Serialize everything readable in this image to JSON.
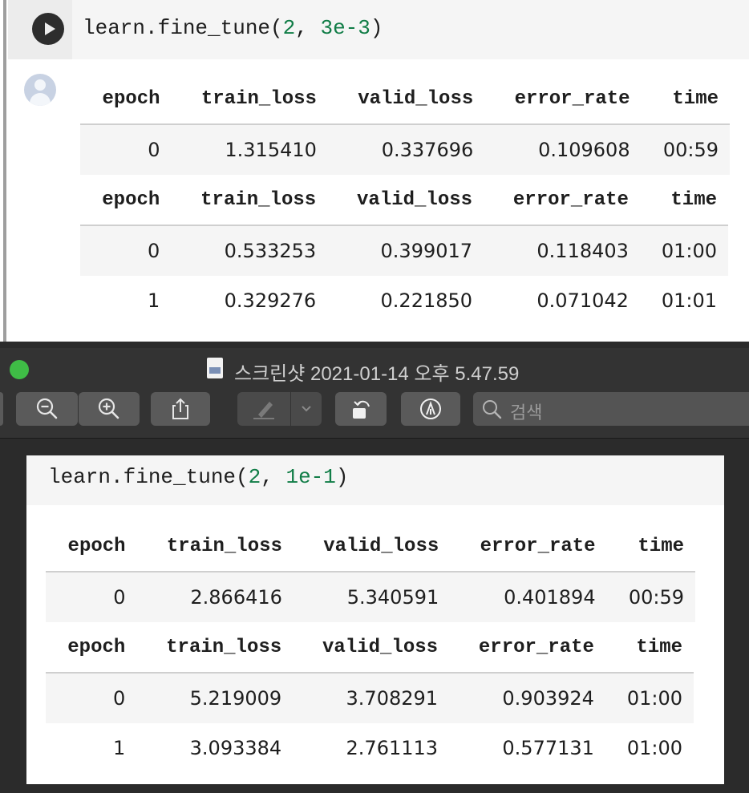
{
  "notebook": {
    "code_prefix": "learn.fine_tune(",
    "code_arg1": "2",
    "code_sep": ", ",
    "code_arg2": "3e-3",
    "code_suffix": ")",
    "headers": [
      "epoch",
      "train_loss",
      "valid_loss",
      "error_rate",
      "time"
    ],
    "table1": [
      [
        "0",
        "1.315410",
        "0.337696",
        "0.109608",
        "00:59"
      ]
    ],
    "table2": [
      [
        "0",
        "0.533253",
        "0.399017",
        "0.118403",
        "01:00"
      ],
      [
        "1",
        "0.329276",
        "0.221850",
        "0.071042",
        "01:01"
      ]
    ]
  },
  "preview_window": {
    "title": "스크린샷 2021-01-14 오후 5.47.59",
    "search_placeholder": "검색",
    "toolbar_icons": [
      "zoom-out-icon",
      "zoom-in-icon",
      "share-icon",
      "markup-pen-icon",
      "chevron-down-icon",
      "rotate-icon",
      "annotate-icon",
      "search-icon"
    ],
    "code_prefix": "learn.fine_tune(",
    "code_arg1": "2",
    "code_sep": ", ",
    "code_arg2": "1e-1",
    "code_suffix": ")",
    "headers": [
      "epoch",
      "train_loss",
      "valid_loss",
      "error_rate",
      "time"
    ],
    "table1": [
      [
        "0",
        "2.866416",
        "5.340591",
        "0.401894",
        "00:59"
      ]
    ],
    "table2": [
      [
        "0",
        "5.219009",
        "3.708291",
        "0.903924",
        "01:00"
      ],
      [
        "1",
        "3.093384",
        "2.761113",
        "0.577131",
        "01:00"
      ]
    ]
  },
  "colors": {
    "number_literal": "#117d47",
    "traffic_light_green": "#3fbd46",
    "row_stripe": "#f5f5f5"
  }
}
